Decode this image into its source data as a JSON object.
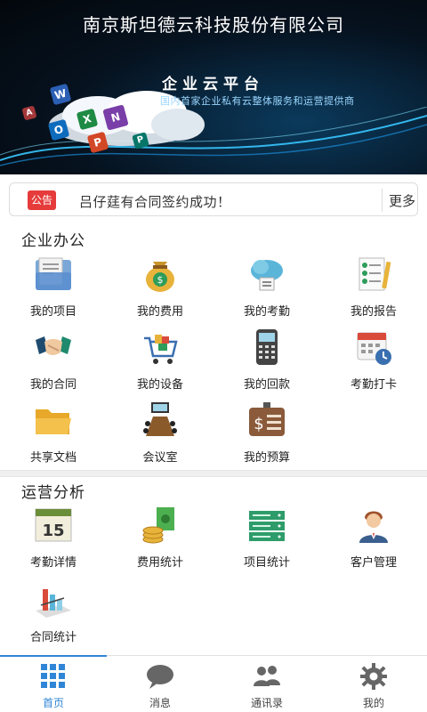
{
  "header": {
    "company_name": "南京斯坦德云科技股份有限公司",
    "brand_title": "企业云平台",
    "tagline": "国内首家企业私有云整体服务和运营提供商"
  },
  "notice": {
    "tag": "公告",
    "message": "吕仔莛有合同签约成功！",
    "more_label": "更多"
  },
  "office": {
    "title": "企业办公",
    "items": [
      {
        "label": "我的项目",
        "icon": "folder-document-icon"
      },
      {
        "label": "我的费用",
        "icon": "money-bag-icon"
      },
      {
        "label": "我的考勤",
        "icon": "cloud-sync-icon"
      },
      {
        "label": "我的报告",
        "icon": "checklist-report-icon"
      },
      {
        "label": "我的合同",
        "icon": "handshake-icon"
      },
      {
        "label": "我的设备",
        "icon": "shopping-cart-icon"
      },
      {
        "label": "我的回款",
        "icon": "pos-terminal-icon"
      },
      {
        "label": "考勤打卡",
        "icon": "calendar-clock-icon"
      },
      {
        "label": "共享文档",
        "icon": "open-folder-icon"
      },
      {
        "label": "会议室",
        "icon": "meeting-table-icon"
      },
      {
        "label": "我的预算",
        "icon": "budget-badge-icon"
      }
    ]
  },
  "operations": {
    "title": "运营分析",
    "items": [
      {
        "label": "考勤详情",
        "icon": "calendar-15-icon",
        "icon_text": "15"
      },
      {
        "label": "费用统计",
        "icon": "coins-cash-icon"
      },
      {
        "label": "项目统计",
        "icon": "server-rack-icon"
      },
      {
        "label": "客户管理",
        "icon": "customer-person-icon"
      },
      {
        "label": "合同统计",
        "icon": "bar-chart-icon"
      }
    ]
  },
  "tabbar": {
    "tabs": [
      {
        "label": "首页",
        "icon": "grid-home-icon",
        "active": true
      },
      {
        "label": "消息",
        "icon": "chat-bubble-icon",
        "active": false
      },
      {
        "label": "通讯录",
        "icon": "contacts-icon",
        "active": false
      },
      {
        "label": "我的",
        "icon": "gear-icon",
        "active": false
      }
    ],
    "active_color": "#2f86d6"
  },
  "colors": {
    "notice_tag": "#e63b3b",
    "banner_dark": "#03070c",
    "banner_accent": "#9ad6ff"
  }
}
